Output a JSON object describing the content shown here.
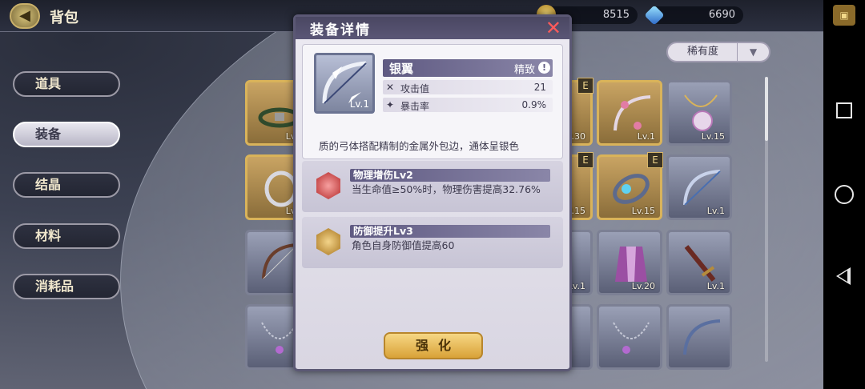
{
  "topbar": {
    "title": "背包",
    "gold": "8515",
    "gems": "6690"
  },
  "sidebar": {
    "items": [
      {
        "label": "道具",
        "active": false
      },
      {
        "label": "装备",
        "active": true
      },
      {
        "label": "结晶",
        "active": false
      },
      {
        "label": "材料",
        "active": false
      },
      {
        "label": "消耗品",
        "active": false
      }
    ]
  },
  "sort": {
    "label": "稀有度"
  },
  "grid": {
    "slots": [
      {
        "lv": "Lv.1",
        "badge": ""
      },
      {
        "lv": "Lv.30",
        "badge": ""
      },
      {
        "lv": "Lv.1",
        "badge": "E"
      },
      {
        "lv": "Lv.15",
        "badge": ""
      },
      {
        "lv": "Lv.1",
        "badge": ""
      },
      {
        "lv": "Lv.15",
        "badge": ""
      },
      {
        "lv": "Lv.15",
        "badge": "E"
      },
      {
        "lv": "Lv.1",
        "badge": ""
      },
      {
        "lv": "Lv.1",
        "badge": ""
      },
      {
        "lv": "Lv.20",
        "badge": ""
      },
      {
        "lv": "Lv.1",
        "badge": ""
      }
    ]
  },
  "modal": {
    "title": "装备详情",
    "close": "✕",
    "item": {
      "name": "银翼",
      "rarity": "精致",
      "level": "Lv.1",
      "stats": [
        {
          "label": "攻击值",
          "value": "21"
        },
        {
          "label": "暴击率",
          "value": "0.9%"
        }
      ],
      "description": "质的弓体搭配精制的金属外包边，通体呈银色"
    },
    "skills": [
      {
        "name": "物理增伤Lv2",
        "description": "当生命值≥50%时，物理伤害提高32.76%"
      },
      {
        "name": "防御提升Lv3",
        "description": "角色自身防御值提高60"
      }
    ],
    "enhance_label": "强化"
  }
}
